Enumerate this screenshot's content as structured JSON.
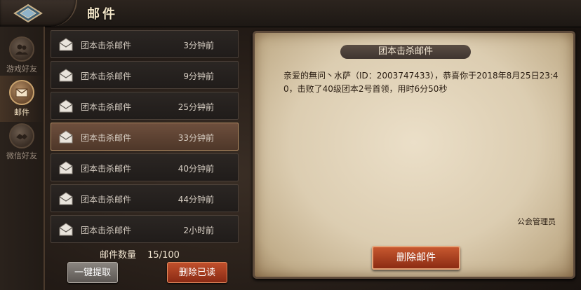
{
  "header": {
    "title": "邮件"
  },
  "sidenav": {
    "items": [
      {
        "label": "游戏好友",
        "icon": "game-friends-icon",
        "active": false
      },
      {
        "label": "邮件",
        "icon": "mail-icon",
        "active": true
      },
      {
        "label": "微信好友",
        "icon": "wechat-friends-icon",
        "active": false
      }
    ]
  },
  "mail_list": {
    "items": [
      {
        "subject": "团本击杀邮件",
        "time": "3分钟前",
        "selected": false
      },
      {
        "subject": "团本击杀邮件",
        "time": "9分钟前",
        "selected": false
      },
      {
        "subject": "团本击杀邮件",
        "time": "25分钟前",
        "selected": false
      },
      {
        "subject": "团本击杀邮件",
        "time": "33分钟前",
        "selected": true
      },
      {
        "subject": "团本击杀邮件",
        "time": "40分钟前",
        "selected": false
      },
      {
        "subject": "团本击杀邮件",
        "time": "44分钟前",
        "selected": false
      },
      {
        "subject": "团本击杀邮件",
        "time": "2小时前",
        "selected": false
      }
    ],
    "count_label": "邮件数量",
    "count_value": "15/100",
    "collect_all_label": "一键提取",
    "delete_read_label": "删除已读"
  },
  "detail": {
    "title": "团本击杀邮件",
    "body": "亲爱的無问丶水萨（ID：2003747433），恭喜你于2018年8月25日23:40，击败了40级团本2号首领，用时6分50秒",
    "sender": "公会管理员",
    "delete_label": "删除邮件"
  },
  "colors": {
    "accent_red": "#a8401f",
    "selected_row": "#6e4f3d",
    "parchment": "#e4d7bd"
  }
}
